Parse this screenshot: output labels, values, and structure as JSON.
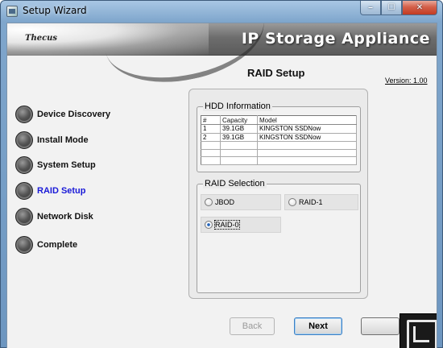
{
  "window": {
    "title": "Setup Wizard",
    "controls": {
      "minimize": "–",
      "maximize": "☐",
      "close": "✕"
    }
  },
  "banner": {
    "logo_text": "Thecus",
    "title": "IP Storage Appliance"
  },
  "sidebar": {
    "steps": [
      {
        "label": "Device Discovery",
        "active": false
      },
      {
        "label": "Install Mode",
        "active": false
      },
      {
        "label": "System Setup",
        "active": false
      },
      {
        "label": "RAID Setup",
        "active": true
      },
      {
        "label": "Network Disk",
        "active": false
      },
      {
        "label": "Complete",
        "active": false
      }
    ]
  },
  "main": {
    "page_title": "RAID Setup",
    "version": "Version: 1.00",
    "hdd_information": {
      "label": "HDD Information",
      "columns": [
        "#",
        "Capacity",
        "Model"
      ],
      "rows": [
        [
          "1",
          "39.1GB",
          "KINGSTON SSDNow"
        ],
        [
          "2",
          "39.1GB",
          "KINGSTON SSDNow"
        ]
      ]
    },
    "raid_selection": {
      "label": "RAID Selection",
      "options": [
        {
          "label": "JBOD",
          "selected": false
        },
        {
          "label": "RAID-1",
          "selected": false
        },
        {
          "label": "RAID-0",
          "selected": true
        }
      ]
    }
  },
  "footer": {
    "back_label": "Back",
    "next_label": "Next"
  },
  "colors": {
    "active_step": "#1a1ad8",
    "title_bar": "#7fa6cc",
    "close_button": "#c23b22"
  }
}
